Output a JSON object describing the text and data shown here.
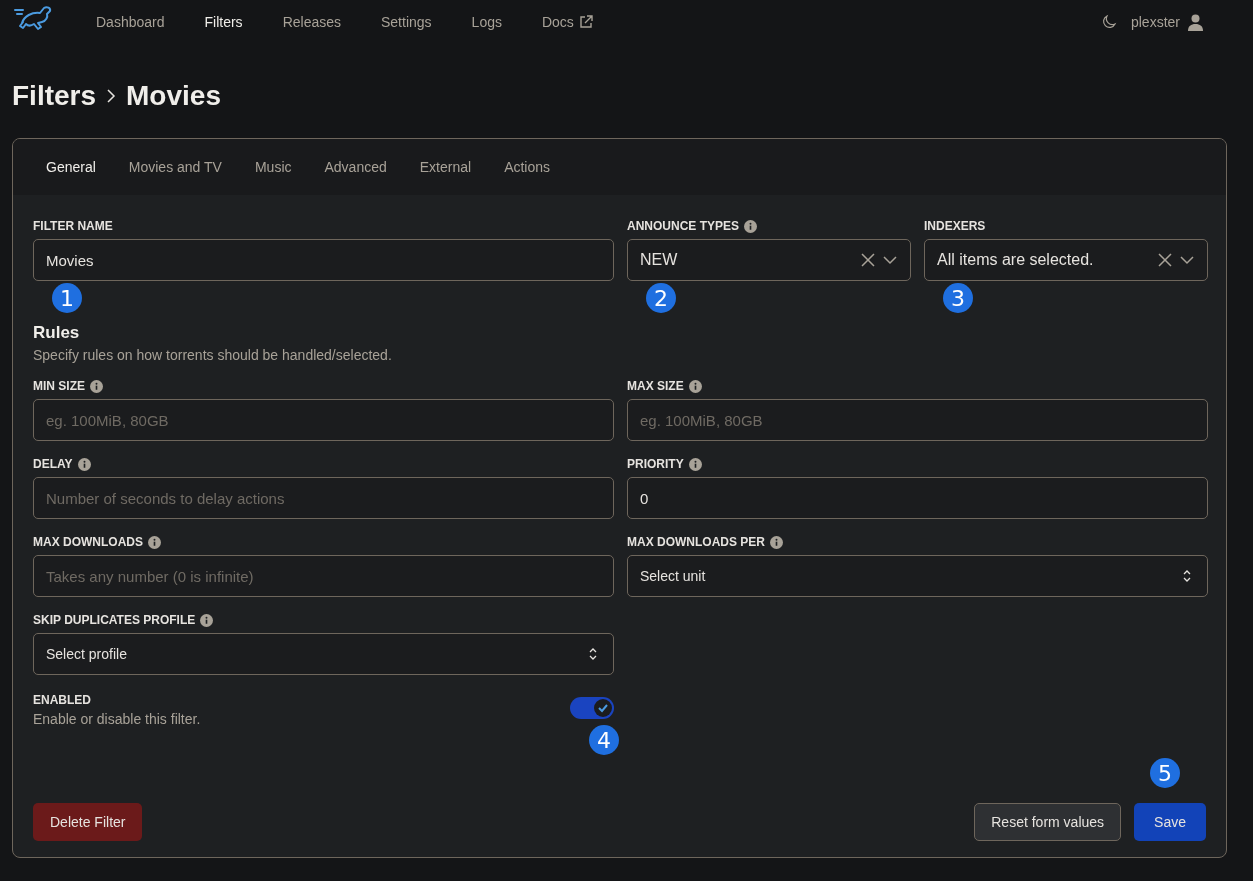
{
  "nav": {
    "items": [
      {
        "label": "Dashboard",
        "selected": false,
        "external": false
      },
      {
        "label": "Filters",
        "selected": true,
        "external": false
      },
      {
        "label": "Releases",
        "selected": false,
        "external": false
      },
      {
        "label": "Settings",
        "selected": false,
        "external": false
      },
      {
        "label": "Logs",
        "selected": false,
        "external": false
      },
      {
        "label": "Docs",
        "selected": false,
        "external": true
      }
    ],
    "user": "plexster"
  },
  "breadcrumb": [
    "Filters",
    "Movies"
  ],
  "tabs": [
    {
      "label": "General",
      "selected": true
    },
    {
      "label": "Movies and TV",
      "selected": false
    },
    {
      "label": "Music",
      "selected": false
    },
    {
      "label": "Advanced",
      "selected": false
    },
    {
      "label": "External",
      "selected": false
    },
    {
      "label": "Actions",
      "selected": false
    }
  ],
  "top_fields": [
    {
      "kind": "text",
      "label": "FILTER NAME",
      "info": false,
      "value": "Movies",
      "callout": "1"
    },
    {
      "kind": "multiselect",
      "label": "ANNOUNCE TYPES",
      "info": true,
      "value": "NEW",
      "callout": "2"
    },
    {
      "kind": "multiselect",
      "label": "INDEXERS",
      "info": false,
      "value": "All items are selected.",
      "callout": "3"
    }
  ],
  "rules": {
    "title": "Rules",
    "description": "Specify rules on how torrents should be handled/selected.",
    "fields": [
      {
        "kind": "text",
        "label": "MIN SIZE",
        "info": true,
        "placeholder": "eg. 100MiB, 80GB"
      },
      {
        "kind": "text",
        "label": "MAX SIZE",
        "info": true,
        "placeholder": "eg. 100MiB, 80GB"
      },
      {
        "kind": "text",
        "label": "DELAY",
        "info": true,
        "placeholder": "Number of seconds to delay actions"
      },
      {
        "kind": "text",
        "label": "PRIORITY",
        "info": true,
        "value": "0"
      },
      {
        "kind": "text",
        "label": "MAX DOWNLOADS",
        "info": true,
        "placeholder": "Takes any number (0 is infinite)"
      },
      {
        "kind": "select",
        "label": "MAX DOWNLOADS PER",
        "info": true,
        "value": "Select unit"
      },
      {
        "kind": "select",
        "label": "SKIP DUPLICATES PROFILE",
        "info": true,
        "value": "Select profile"
      }
    ]
  },
  "enabled": {
    "label": "ENABLED",
    "description": "Enable or disable this filter.",
    "on": true,
    "callout": "4"
  },
  "buttons": [
    {
      "kind": "danger",
      "label": "Delete Filter"
    },
    {
      "kind": "secondary",
      "label": "Reset form values"
    },
    {
      "kind": "primary",
      "label": "Save",
      "callout": "5"
    }
  ]
}
